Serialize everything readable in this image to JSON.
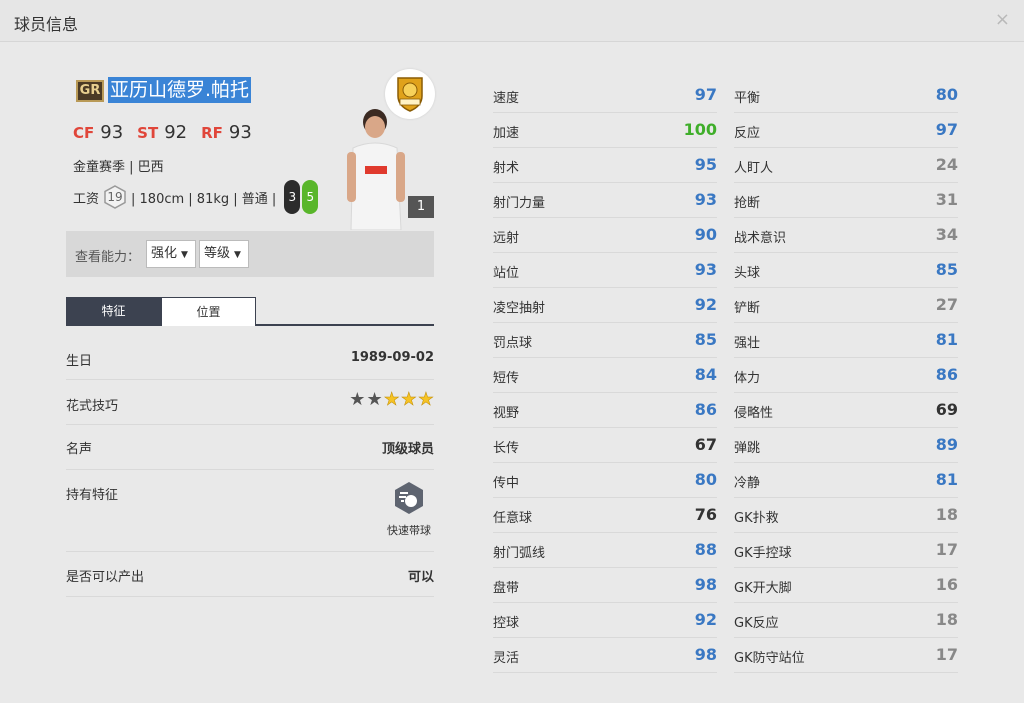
{
  "window": {
    "title": "球员信息",
    "close_label": "×"
  },
  "player": {
    "grade": "GR",
    "name": "亚历山德罗.帕托",
    "positions": [
      {
        "code": "CF",
        "rating": "93"
      },
      {
        "code": "ST",
        "rating": "92"
      },
      {
        "code": "RF",
        "rating": "93"
      }
    ],
    "season_line": "金童赛季 | 巴西",
    "salary_label": "工资",
    "salary": "19",
    "body_line": "| 180cm | 81kg | 普通 |",
    "weak_foot": "3",
    "strong_foot": "5",
    "level": "1"
  },
  "view": {
    "label": "查看能力：",
    "select_enhance": "强化",
    "select_level": "等级",
    "arrow": "▼"
  },
  "tabs": [
    {
      "label": "特征"
    },
    {
      "label": "位置"
    }
  ],
  "info": {
    "birthday_label": "生日",
    "birthday_value": "1989-09-02",
    "skill_label": "花式技巧",
    "skill_stars": 5,
    "skill_filled": 2,
    "fame_label": "名声",
    "fame_value": "顶级球员",
    "trait_label": "持有特征",
    "trait_name": "快速带球",
    "produce_label": "是否可以产出",
    "produce_value": "可以"
  },
  "stats_left": [
    {
      "label": "速度",
      "value": "97"
    },
    {
      "label": "加速",
      "value": "100"
    },
    {
      "label": "射术",
      "value": "95"
    },
    {
      "label": "射门力量",
      "value": "93"
    },
    {
      "label": "远射",
      "value": "90"
    },
    {
      "label": "站位",
      "value": "93"
    },
    {
      "label": "凌空抽射",
      "value": "92"
    },
    {
      "label": "罚点球",
      "value": "85"
    },
    {
      "label": "短传",
      "value": "84"
    },
    {
      "label": "视野",
      "value": "86"
    },
    {
      "label": "长传",
      "value": "67"
    },
    {
      "label": "传中",
      "value": "80"
    },
    {
      "label": "任意球",
      "value": "76"
    },
    {
      "label": "射门弧线",
      "value": "88"
    },
    {
      "label": "盘带",
      "value": "98"
    },
    {
      "label": "控球",
      "value": "92"
    },
    {
      "label": "灵活",
      "value": "98"
    }
  ],
  "stats_right": [
    {
      "label": "平衡",
      "value": "80"
    },
    {
      "label": "反应",
      "value": "97"
    },
    {
      "label": "人盯人",
      "value": "24"
    },
    {
      "label": "抢断",
      "value": "31"
    },
    {
      "label": "战术意识",
      "value": "34"
    },
    {
      "label": "头球",
      "value": "85"
    },
    {
      "label": "铲断",
      "value": "27"
    },
    {
      "label": "强壮",
      "value": "81"
    },
    {
      "label": "体力",
      "value": "86"
    },
    {
      "label": "侵略性",
      "value": "69"
    },
    {
      "label": "弹跳",
      "value": "89"
    },
    {
      "label": "冷静",
      "value": "81"
    },
    {
      "label": "GK扑救",
      "value": "18"
    },
    {
      "label": "GK手控球",
      "value": "17"
    },
    {
      "label": "GK开大脚",
      "value": "16"
    },
    {
      "label": "GK反应",
      "value": "18"
    },
    {
      "label": "GK防守站位",
      "value": "17"
    }
  ],
  "colors": {
    "high": "#3a78c3",
    "top": "#3fae2a",
    "mid": "#333333",
    "low": "#888888"
  }
}
